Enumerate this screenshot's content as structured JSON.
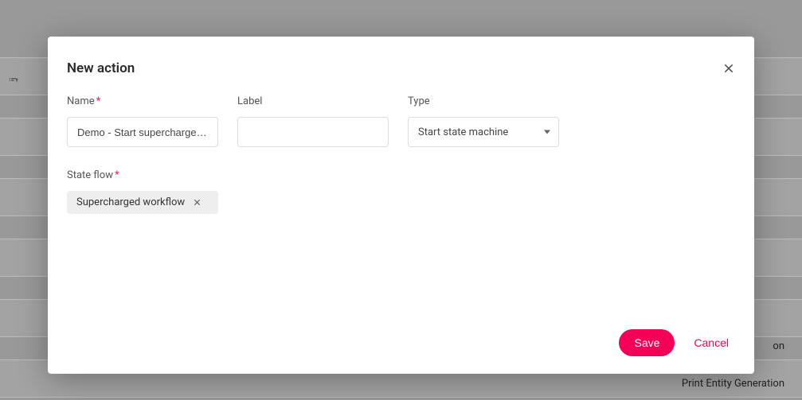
{
  "background": {
    "sort_icon_label": "Z↓",
    "item_partial": "on",
    "item_bottom": "Print Entity Generation"
  },
  "modal": {
    "title": "New action",
    "close_icon_name": "close-icon",
    "fields": {
      "name": {
        "label": "Name",
        "required": true,
        "value": "Demo - Start supercharged w"
      },
      "label": {
        "label": "Label",
        "required": false,
        "value": ""
      },
      "type": {
        "label": "Type",
        "required": false,
        "selected": "Start state machine"
      },
      "state_flow": {
        "label": "State flow",
        "required": true,
        "chip": "Supercharged workflow"
      }
    },
    "actions": {
      "save": "Save",
      "cancel": "Cancel"
    }
  }
}
